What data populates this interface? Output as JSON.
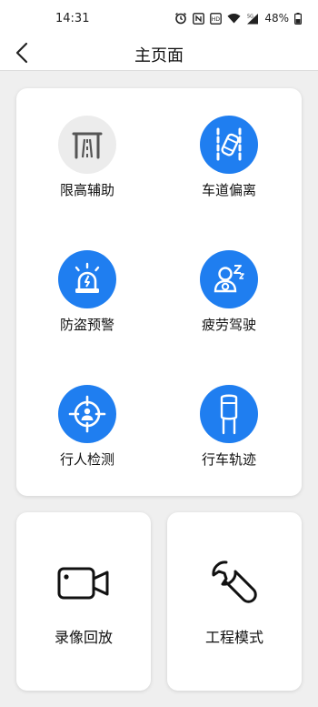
{
  "status_bar": {
    "time": "14:31",
    "battery_percent": "48%",
    "icons": [
      "alarm-icon",
      "nfc-icon",
      "volte-icon",
      "wifi-icon",
      "signal-5g-icon",
      "battery-icon"
    ]
  },
  "header": {
    "back_icon": "chevron-left-icon",
    "title": "主页面"
  },
  "colors": {
    "accent": "#1f7ef0",
    "inactive": "#ececec",
    "inactive_icon": "#555555"
  },
  "features": [
    {
      "label": "限高辅助",
      "icon": "height-limit-icon",
      "active": false
    },
    {
      "label": "车道偏离",
      "icon": "lane-departure-icon",
      "active": true
    },
    {
      "label": "防盗预警",
      "icon": "alarm-siren-icon",
      "active": true
    },
    {
      "label": "疲劳驾驶",
      "icon": "fatigue-driver-icon",
      "active": true
    },
    {
      "label": "行人检测",
      "icon": "pedestrian-target-icon",
      "active": true
    },
    {
      "label": "行车轨迹",
      "icon": "car-track-icon",
      "active": true
    }
  ],
  "bottom_cards": [
    {
      "label": "录像回放",
      "icon": "video-camera-icon"
    },
    {
      "label": "工程模式",
      "icon": "wrench-icon"
    }
  ]
}
